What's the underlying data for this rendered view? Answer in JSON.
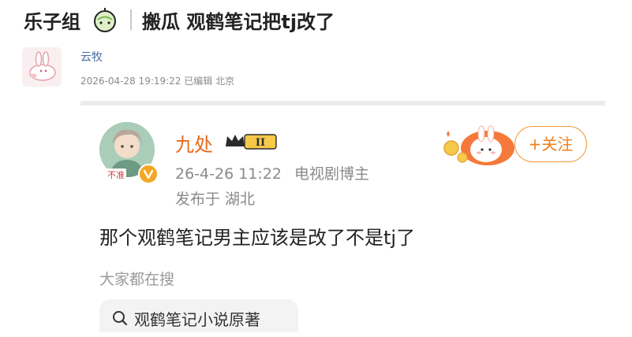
{
  "header": {
    "group_name": "乐子组",
    "post_title": "搬瓜 观鹤笔记把tj改了",
    "group_icon": "melon-icon"
  },
  "post": {
    "poster_name": "云牧",
    "date": "2026-04-28 19:19:22",
    "edited": "已编辑",
    "location": "北京",
    "avatar_icon": "bunny-avatar"
  },
  "quoted_card": {
    "author_name": "九处",
    "level_badge": "II",
    "avatar_tag": "不准",
    "time": "26-4-26 11:22",
    "role": "电视剧博主",
    "published_from": "发布于 湖北",
    "follow_button": "+关注",
    "content": "那个观鹤笔记男主应该是改了不是tj了",
    "search_hint": "大家都在搜",
    "search_query": "观鹤笔记小说原著"
  },
  "colors": {
    "name_orange": "#e86a1c",
    "link_blue": "#4a6fa5",
    "meta_gray": "#8a8a8a",
    "follow_border": "#f39a3b"
  }
}
